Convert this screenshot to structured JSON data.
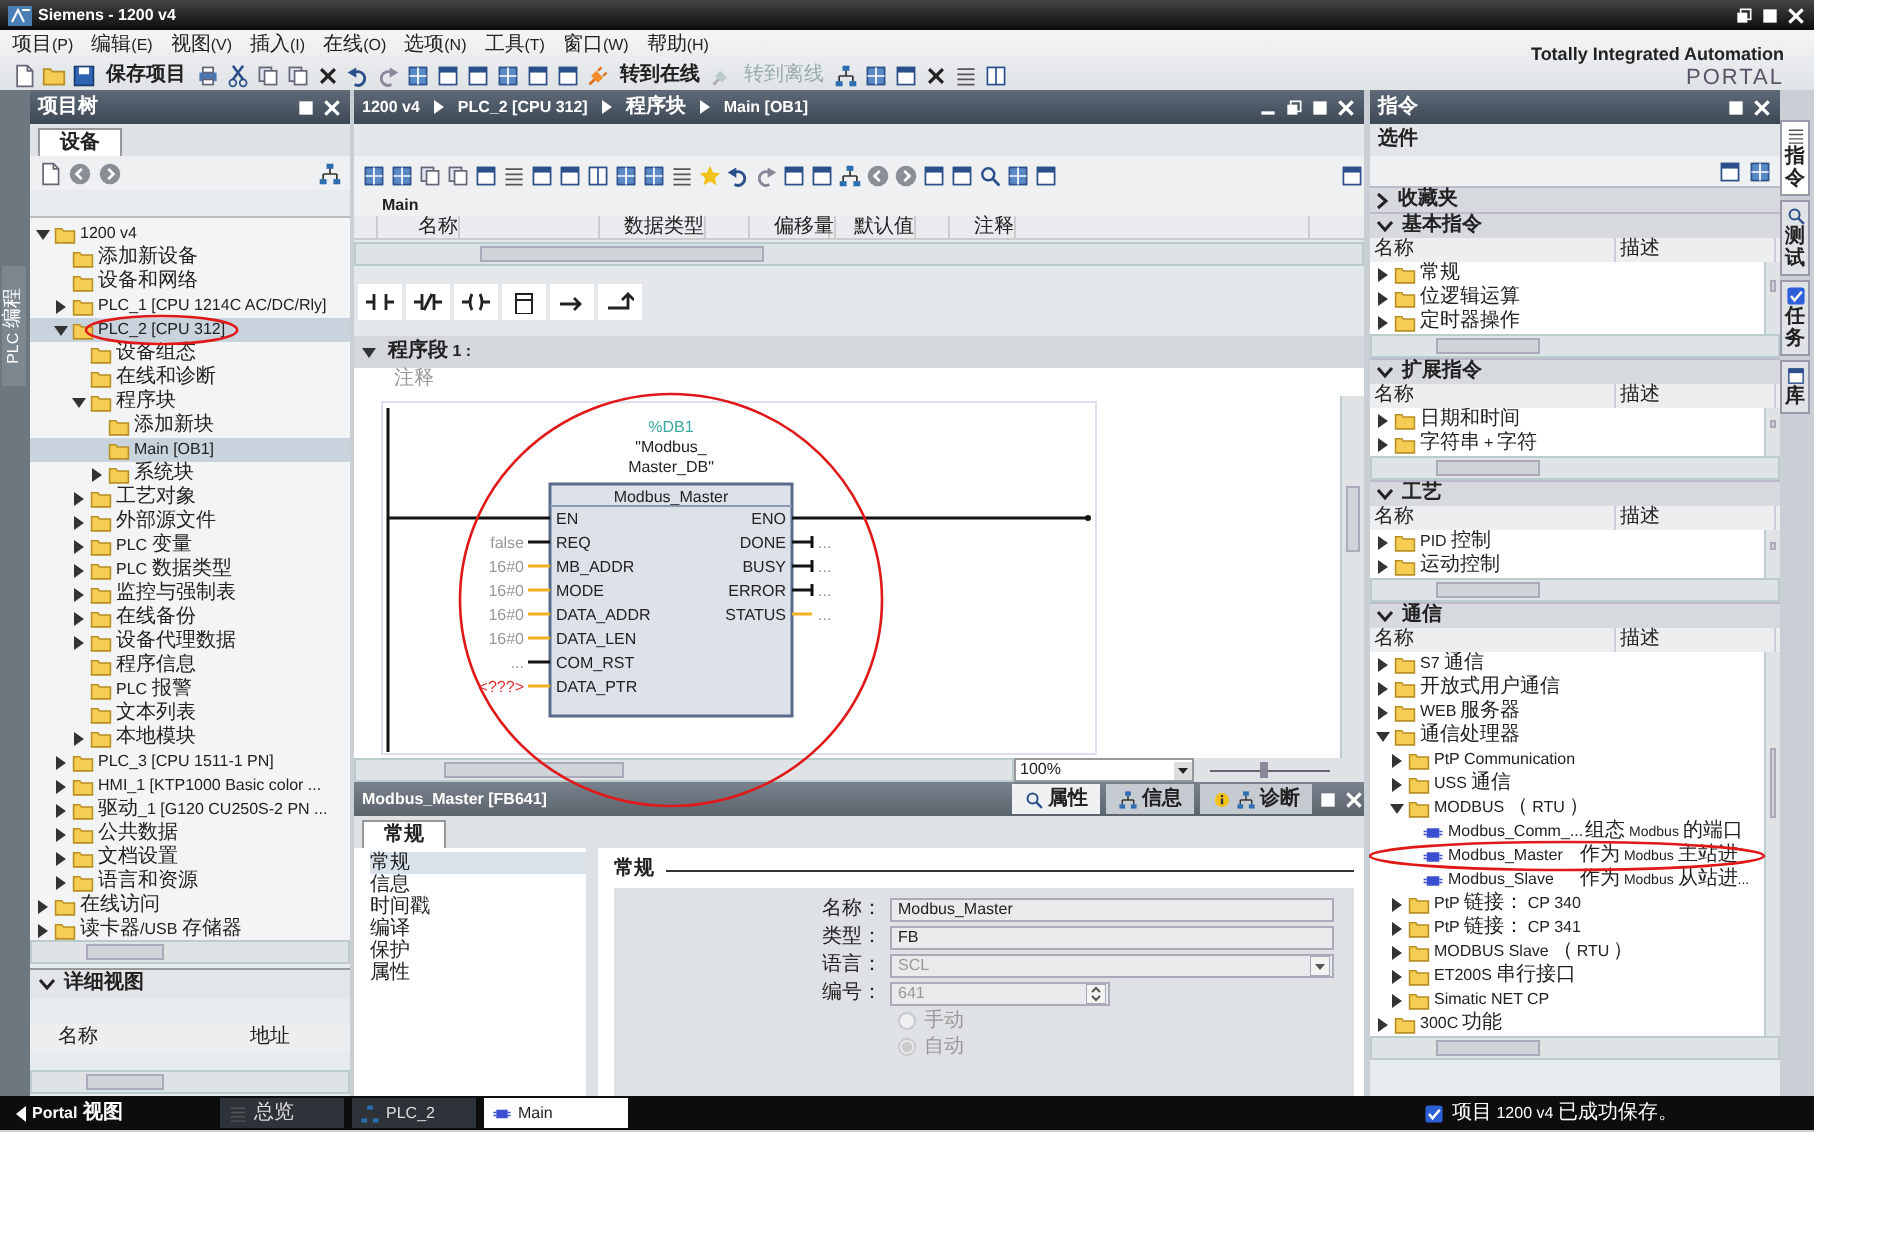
{
  "window": {
    "title": "Siemens - 1200 v4"
  },
  "menu": [
    "项目(P)",
    "编辑(E)",
    "视图(V)",
    "插入(I)",
    "在线(O)",
    "选项(N)",
    "工具(T)",
    "窗口(W)",
    "帮助(H)"
  ],
  "toolbar_buttons": [
    {
      "label": "保存项目",
      "disabled": false
    },
    {
      "label": "转到在线",
      "disabled": false
    },
    {
      "label": "转到离线",
      "disabled": true
    }
  ],
  "brand": {
    "line1": "Totally Integrated Automation",
    "line2": "PORTAL"
  },
  "left_tab": "PLC 编程",
  "project_tree": {
    "title": "项目树",
    "tab": "设备",
    "items": [
      {
        "label": "1200 v4",
        "expanded": true,
        "selected": false,
        "children": [
          {
            "label": "添加新设备",
            "selected": false
          },
          {
            "label": "设备和网络",
            "selected": false
          },
          {
            "label": "PLC_1 [CPU 1214C AC/DC/Rly]",
            "expanded": false,
            "selected": false
          },
          {
            "label": "PLC_2 [CPU 312]",
            "expanded": true,
            "selected": true,
            "children": [
              {
                "label": "设备组态",
                "selected": false
              },
              {
                "label": "在线和诊断",
                "selected": false
              },
              {
                "label": "程序块",
                "expanded": true,
                "selected": false,
                "children": [
                  {
                    "label": "添加新块",
                    "selected": false
                  },
                  {
                    "label": "Main [OB1]",
                    "selected": true
                  },
                  {
                    "label": "系统块",
                    "expanded": false,
                    "selected": false
                  }
                ]
              },
              {
                "label": "工艺对象",
                "expanded": false,
                "selected": false
              },
              {
                "label": "外部源文件",
                "expanded": false,
                "selected": false
              },
              {
                "label": "PLC 变量",
                "expanded": false,
                "selected": false
              },
              {
                "label": "PLC 数据类型",
                "expanded": false,
                "selected": false
              },
              {
                "label": "监控与强制表",
                "expanded": false,
                "selected": false
              },
              {
                "label": "在线备份",
                "expanded": false,
                "selected": false
              },
              {
                "label": "设备代理数据",
                "expanded": false,
                "selected": false
              },
              {
                "label": "程序信息",
                "selected": false
              },
              {
                "label": "PLC 报警",
                "selected": false
              },
              {
                "label": "文本列表",
                "selected": false
              },
              {
                "label": "本地模块",
                "expanded": false,
                "selected": false
              }
            ]
          },
          {
            "label": "PLC_3 [CPU 1511-1 PN]",
            "expanded": false,
            "selected": false
          },
          {
            "label": "HMI_1 [KTP1000 Basic color ...",
            "expanded": false,
            "selected": false
          },
          {
            "label": "驱动_1 [G120 CU250S-2 PN ...",
            "expanded": false,
            "selected": false
          },
          {
            "label": "公共数据",
            "expanded": false,
            "selected": false
          },
          {
            "label": "文档设置",
            "expanded": false,
            "selected": false
          },
          {
            "label": "语言和资源",
            "expanded": false,
            "selected": false
          }
        ]
      },
      {
        "label": "在线访问",
        "expanded": false,
        "selected": false
      },
      {
        "label": "读卡器/USB 存储器",
        "expanded": false,
        "selected": false
      }
    ]
  },
  "detail_view": {
    "title": "详细视图",
    "expanded": true,
    "columns": [
      "名称",
      "地址"
    ]
  },
  "editor": {
    "breadcrumb": [
      "1200 v4",
      "PLC_2 [CPU 312]",
      "程序块",
      "Main [OB1]"
    ],
    "block_name": "Main",
    "interface_columns": [
      "名称",
      "数据类型",
      "偏移量",
      "默认值",
      "注释"
    ],
    "network": {
      "title": "程序段 1 :",
      "expanded": true,
      "comment": "注释",
      "instance_address": "%DB1",
      "instance_lines": [
        "\"Modbus_",
        "Master_DB\""
      ],
      "block_type": "Modbus_Master",
      "inputs": [
        {
          "pin": "EN",
          "kind": "enable"
        },
        {
          "pin": "REQ",
          "value": "false",
          "kind": "bool",
          "invalid": false
        },
        {
          "pin": "MB_ADDR",
          "value": "16#0",
          "kind": "word",
          "invalid": false
        },
        {
          "pin": "MODE",
          "value": "16#0",
          "kind": "word",
          "invalid": false
        },
        {
          "pin": "DATA_ADDR",
          "value": "16#0",
          "kind": "word",
          "invalid": false
        },
        {
          "pin": "DATA_LEN",
          "value": "16#0",
          "kind": "word",
          "invalid": false
        },
        {
          "pin": "COM_RST",
          "value": "...",
          "kind": "bool",
          "invalid": false
        },
        {
          "pin": "DATA_PTR",
          "value": "<???>",
          "kind": "word",
          "invalid": true
        }
      ],
      "outputs": [
        {
          "pin": "ENO",
          "kind": "enable"
        },
        {
          "pin": "DONE",
          "value": "...",
          "kind": "bool"
        },
        {
          "pin": "BUSY",
          "value": "...",
          "kind": "bool"
        },
        {
          "pin": "ERROR",
          "value": "...",
          "kind": "bool"
        },
        {
          "pin": "STATUS",
          "value": "...",
          "kind": "word"
        }
      ]
    },
    "zoom": "100%",
    "zoom_slider": {
      "level": 0.45
    }
  },
  "properties": {
    "title": "Modbus_Master [FB641]",
    "tabs": [
      {
        "label": "属性",
        "selected": true
      },
      {
        "label": "信息",
        "selected": false
      },
      {
        "label": "诊断",
        "selected": false
      }
    ],
    "subtab": "常规",
    "nav": [
      {
        "label": "常规",
        "selected": true
      },
      {
        "label": "信息",
        "selected": false
      },
      {
        "label": "时间戳",
        "selected": false
      },
      {
        "label": "编译",
        "selected": false
      },
      {
        "label": "保护",
        "selected": false
      },
      {
        "label": "属性",
        "selected": false
      }
    ],
    "section": "常规",
    "fields": [
      {
        "label": "名称：",
        "value": "Modbus_Master",
        "kind": "text",
        "disabled": false
      },
      {
        "label": "类型：",
        "value": "FB",
        "kind": "text",
        "disabled": false
      },
      {
        "label": "语言：",
        "value": "SCL",
        "kind": "select",
        "disabled": true
      },
      {
        "label": "编号：",
        "value": "641",
        "kind": "spin",
        "disabled": true
      }
    ],
    "radios": [
      {
        "label": "手动",
        "checked": false,
        "disabled": true
      },
      {
        "label": "自动",
        "checked": true,
        "disabled": true
      }
    ]
  },
  "instructions": {
    "title": "指令",
    "options": "选件",
    "sections": [
      {
        "title": "收藏夹",
        "expanded": false
      },
      {
        "title": "基本指令",
        "expanded": true,
        "columns": [
          "名称",
          "描述"
        ],
        "rows": [
          {
            "label": "常规",
            "kind": "folder",
            "expanded": false
          },
          {
            "label": "位逻辑运算",
            "kind": "folder",
            "expanded": false
          },
          {
            "label": "定时器操作",
            "kind": "folder",
            "expanded": false
          }
        ]
      },
      {
        "title": "扩展指令",
        "expanded": true,
        "columns": [
          "名称",
          "描述"
        ],
        "rows": [
          {
            "label": "日期和时间",
            "kind": "folder",
            "expanded": false
          },
          {
            "label": "字符串 + 字符",
            "kind": "folder",
            "expanded": false
          }
        ]
      },
      {
        "title": "工艺",
        "expanded": true,
        "columns": [
          "名称",
          "描述"
        ],
        "rows": [
          {
            "label": "PID 控制",
            "kind": "folder",
            "expanded": false
          },
          {
            "label": "运动控制",
            "kind": "folder",
            "expanded": false
          }
        ]
      },
      {
        "title": "通信",
        "expanded": true,
        "columns": [
          "名称",
          "描述"
        ],
        "rows": [
          {
            "label": "S7 通信",
            "kind": "folder",
            "expanded": false
          },
          {
            "label": "开放式用户通信",
            "kind": "folder",
            "expanded": false
          },
          {
            "label": "WEB 服务器",
            "kind": "folder",
            "expanded": false
          },
          {
            "label": "通信处理器",
            "kind": "folder",
            "expanded": true,
            "children": [
              {
                "label": "PtP Communication",
                "kind": "folder",
                "expanded": false
              },
              {
                "label": "USS 通信",
                "kind": "folder",
                "expanded": false
              },
              {
                "label": "MODBUS（RTU）",
                "kind": "folder",
                "expanded": true,
                "children": [
                  {
                    "label": "Modbus_Comm_...",
                    "kind": "instruction",
                    "description": "组态 Modbus 的端口"
                  },
                  {
                    "label": "Modbus_Master",
                    "kind": "instruction",
                    "description": "作为 Modbus 主站进"
                  },
                  {
                    "label": "Modbus_Slave",
                    "kind": "instruction",
                    "description": "作为 Modbus 从站进..."
                  }
                ]
              },
              {
                "label": "PtP 链接：CP 340",
                "kind": "folder",
                "expanded": false
              },
              {
                "label": "PtP 链接：CP 341",
                "kind": "folder",
                "expanded": false
              },
              {
                "label": "MODBUS Slave（RTU）",
                "kind": "folder",
                "expanded": false
              },
              {
                "label": "ET200S 串行接口",
                "kind": "folder",
                "expanded": false
              },
              {
                "label": "Simatic NET CP",
                "kind": "folder",
                "expanded": false
              }
            ]
          },
          {
            "label": "300C 功能",
            "kind": "folder",
            "expanded": false
          }
        ]
      }
    ]
  },
  "side_tabs": [
    {
      "label": "指令",
      "selected": true
    },
    {
      "label": "测试",
      "selected": false
    },
    {
      "label": "任务",
      "selected": false
    },
    {
      "label": "库",
      "selected": false
    }
  ],
  "taskbar": {
    "portal": "Portal 视图",
    "tabs": [
      {
        "label": "总览",
        "selected": false
      },
      {
        "label": "PLC_2",
        "selected": false
      },
      {
        "label": "Main",
        "selected": true
      }
    ],
    "status": "项目 1200 v4 已成功保存。"
  }
}
